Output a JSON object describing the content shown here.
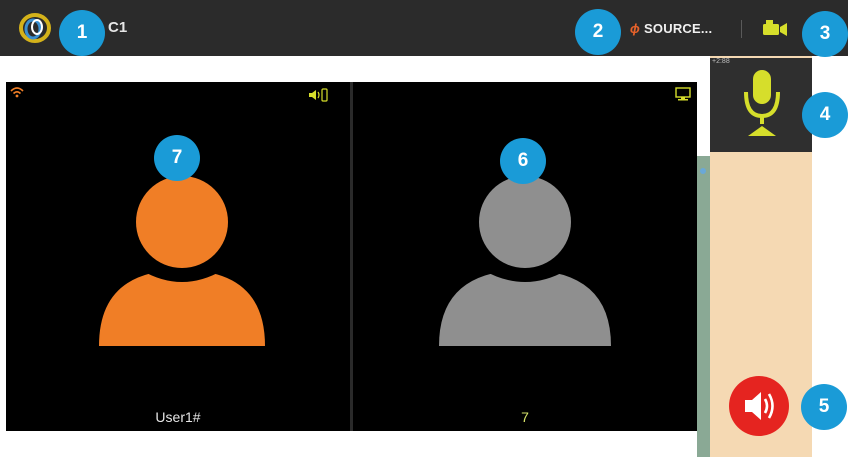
{
  "topbar": {
    "title": "C1",
    "source_label": "SOURCE...",
    "source_glyph": "ɸ"
  },
  "mic": {
    "time": "+2:88"
  },
  "tiles": [
    {
      "label": "User1#",
      "avatar_color": "#f07e26"
    },
    {
      "label": "7",
      "avatar_color": "#8f8f8f"
    }
  ],
  "badges": [
    "1",
    "2",
    "3",
    "4",
    "5",
    "6",
    "7"
  ],
  "colors": {
    "accent_yellow": "#d6de2b",
    "speaker_red": "#e52420",
    "badge_blue": "#1a9bd7"
  }
}
